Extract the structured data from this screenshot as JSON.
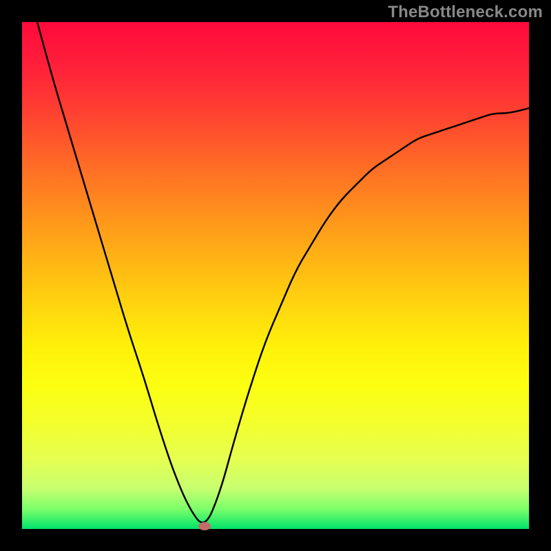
{
  "watermark": "TheBottleneck.com",
  "colors": {
    "background": "#000000",
    "curve_stroke": "#000000",
    "marker_fill": "#c36a6a",
    "gradient_top": "#ff0a3c",
    "gradient_bottom": "#00e36a"
  },
  "chart_data": {
    "type": "line",
    "title": "",
    "xlabel": "",
    "ylabel": "",
    "xlim": [
      0,
      100
    ],
    "ylim": [
      0,
      100
    ],
    "series": [
      {
        "name": "bottleneck-curve",
        "x": [
          3,
          6,
          9,
          12,
          15,
          18,
          21,
          24,
          27,
          30,
          33,
          36,
          39,
          42,
          45,
          48,
          51,
          54,
          57,
          60,
          63,
          66,
          69,
          72,
          75,
          78,
          81,
          84,
          87,
          90,
          93,
          96,
          100
        ],
        "y": [
          100,
          89,
          79,
          69,
          59,
          49,
          39,
          30,
          20,
          11,
          4,
          0,
          7,
          18,
          28,
          37,
          44,
          51,
          56,
          61,
          65,
          68,
          71,
          73,
          75,
          77,
          78,
          79,
          80,
          81,
          82,
          82,
          83
        ]
      }
    ],
    "marker": {
      "x": 36,
      "y": 0
    },
    "annotations": []
  }
}
